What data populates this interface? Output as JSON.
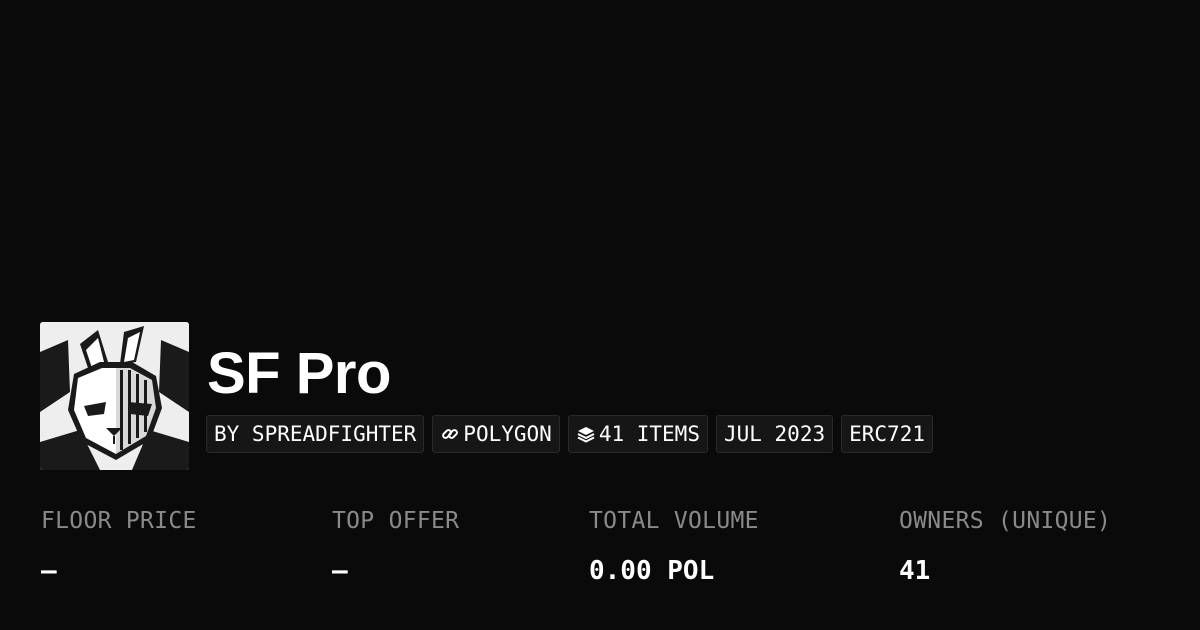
{
  "collection": {
    "name": "SF Pro",
    "avatar_icon": "spreadfighter-rabbit-logo"
  },
  "chips": [
    {
      "label": "BY SPREADFIGHTER"
    },
    {
      "label": "POLYGON",
      "icon": "chain-link-icon"
    },
    {
      "label": "41 ITEMS",
      "icon": "layers-stack-icon"
    },
    {
      "label": "JUL 2023"
    },
    {
      "label": "ERC721"
    }
  ],
  "stats": [
    {
      "label": "FLOOR PRICE",
      "value": "–"
    },
    {
      "label": "TOP OFFER",
      "value": "–"
    },
    {
      "label": "TOTAL VOLUME",
      "value": "0.00 POL"
    },
    {
      "label": "OWNERS (UNIQUE)",
      "value": "41"
    }
  ],
  "colors": {
    "background": "#0a0a0a",
    "text": "#ffffff",
    "label": "#8a8a8a",
    "chip_background": "#161616",
    "chip_border": "#2a2a2a"
  }
}
